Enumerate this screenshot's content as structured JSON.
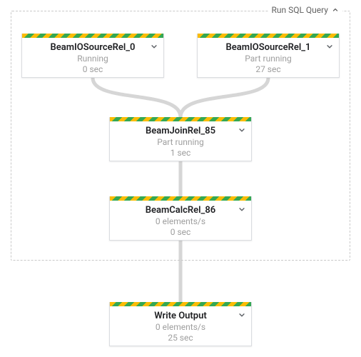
{
  "container": {
    "title": "Run SQL Query"
  },
  "nodes": {
    "src0": {
      "title": "BeamIOSourceRel_0",
      "status": "Running",
      "time": "0 sec"
    },
    "src1": {
      "title": "BeamIOSourceRel_1",
      "status": "Part running",
      "time": "27 sec"
    },
    "join": {
      "title": "BeamJoinRel_85",
      "status": "Part running",
      "time": "1 sec"
    },
    "calc": {
      "title": "BeamCalcRel_86",
      "status": "0 elements/s",
      "time": "0 sec"
    },
    "write": {
      "title": "Write Output",
      "status": "0 elements/s",
      "time": "25 sec"
    }
  }
}
